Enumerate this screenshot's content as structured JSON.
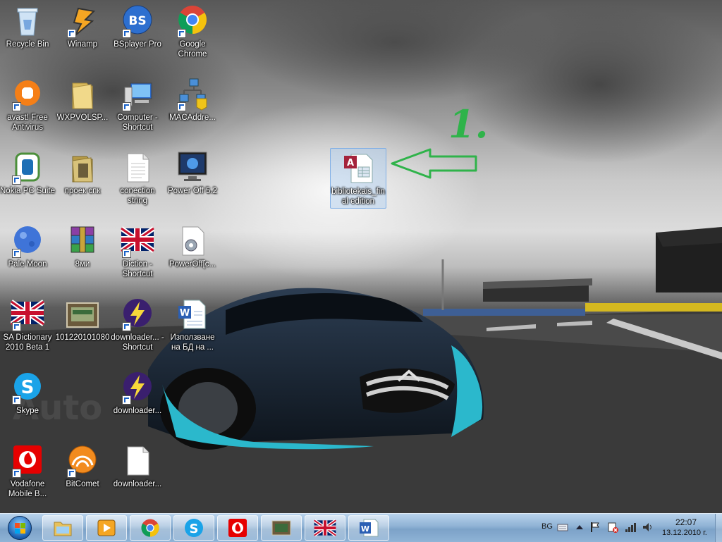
{
  "desktop": {
    "icons": [
      {
        "label": "Recycle Bin",
        "icon": "recycle-bin-icon",
        "shortcut": false
      },
      {
        "label": "Winamp",
        "icon": "winamp-icon",
        "shortcut": true
      },
      {
        "label": "BSplayer Pro",
        "icon": "bsplayer-icon",
        "shortcut": true
      },
      {
        "label": "Google Chrome",
        "icon": "chrome-icon",
        "shortcut": true
      },
      {
        "label": "avast! Free Antivirus",
        "icon": "avast-icon",
        "shortcut": true
      },
      {
        "label": "WXPVOLSP...",
        "icon": "folder-icon",
        "shortcut": false
      },
      {
        "label": "Computer - Shortcut",
        "icon": "computer-icon",
        "shortcut": true
      },
      {
        "label": "MACAddre...",
        "icon": "network-icon",
        "shortcut": true
      },
      {
        "label": "Nokia PC Suite",
        "icon": "nokia-icon",
        "shortcut": true
      },
      {
        "label": "проек спк",
        "icon": "folder-icon",
        "shortcut": false
      },
      {
        "label": "conection string",
        "icon": "text-file-icon",
        "shortcut": false
      },
      {
        "label": "Power Off 5.2",
        "icon": "monitor-icon",
        "shortcut": false
      },
      {
        "label": "Pale Moon",
        "icon": "pale-moon-icon",
        "shortcut": true
      },
      {
        "label": "8ми",
        "icon": "winrar-icon",
        "shortcut": false
      },
      {
        "label": "Diction - Shortcut",
        "icon": "uk-flag-icon",
        "shortcut": true
      },
      {
        "label": "PowerOff[c...",
        "icon": "config-file-icon",
        "shortcut": false
      },
      {
        "label": "SA Dictionary 2010 Beta 1",
        "icon": "uk-flag-icon",
        "shortcut": true
      },
      {
        "label": "101220101080",
        "icon": "image-icon",
        "shortcut": false
      },
      {
        "label": "downloader... - Shortcut",
        "icon": "downloader-icon",
        "shortcut": true
      },
      {
        "label": "Използване на БД на ...",
        "icon": "word-doc-icon",
        "shortcut": false
      },
      {
        "label": "Skype",
        "icon": "skype-icon",
        "shortcut": true
      },
      {
        "label": "downloader...",
        "icon": "downloader-icon",
        "shortcut": true
      },
      {
        "label": "Vodafone Mobile B...",
        "icon": "vodafone-icon",
        "shortcut": true
      },
      {
        "label": "BitComet",
        "icon": "bitcomet-icon",
        "shortcut": true
      },
      {
        "label": "downloader...",
        "icon": "text-file-icon",
        "shortcut": false
      },
      {
        "label": "bibliotekais_final edition",
        "icon": "access-db-icon",
        "shortcut": false,
        "selected": true
      }
    ],
    "annotation": {
      "text": "1.",
      "color": "#2fb34a"
    }
  },
  "taskbar": {
    "buttons": [
      {
        "name": "explorer-icon"
      },
      {
        "name": "media-player-icon"
      },
      {
        "name": "chrome-icon"
      },
      {
        "name": "skype-icon"
      },
      {
        "name": "vodafone-icon"
      },
      {
        "name": "image-icon"
      },
      {
        "name": "uk-flag-icon"
      },
      {
        "name": "word-icon"
      }
    ],
    "tray": {
      "language": "BG",
      "time": "22:07",
      "date": "13.12.2010 г."
    }
  }
}
